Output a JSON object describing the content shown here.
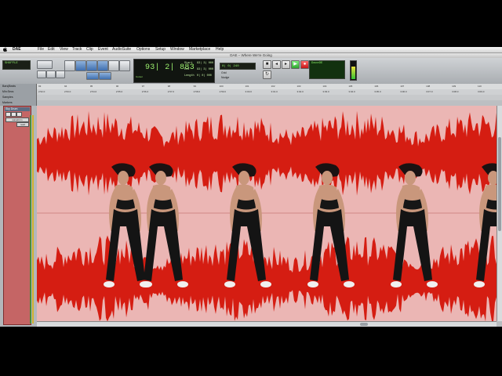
{
  "menubar": {
    "apple_icon": "apple-icon",
    "app": "DAE",
    "items": [
      "File",
      "Edit",
      "View",
      "Track",
      "Clip",
      "Event",
      "AudioSuite",
      "Options",
      "Setup",
      "Window",
      "Marketplace",
      "Help"
    ]
  },
  "window": {
    "title": "DAE – Where We're Going"
  },
  "toolbar": {
    "main_counter": "93| 2| 883",
    "counter_caption": "Cursor",
    "counter_side": [
      "Start",
      "End",
      "Length"
    ],
    "counter_side_values": [
      "93| 3| 000",
      "93| 3| 000",
      "0| 0| 000"
    ],
    "nudge_label": "Nudge",
    "grid_label": "Grid",
    "grid_value": "0| 0| 240",
    "left_lcd": "SHUFFLE",
    "right_lcd": "DaveDE"
  },
  "rulers": {
    "labels": [
      "Bars|Beats",
      "Min:Secs",
      "Samples",
      "Markers"
    ],
    "bar_ticks": [
      "93",
      "94",
      "95",
      "96",
      "97",
      "98",
      "99",
      "100",
      "101",
      "102",
      "103",
      "104",
      "105",
      "106",
      "107",
      "108",
      "109",
      "110"
    ],
    "time_ticks": [
      "2:52.0",
      "2:53.0",
      "2:54.0",
      "2:55.0",
      "2:56.0",
      "2:57.0",
      "2:58.0",
      "2:59.0",
      "3:00.0",
      "3:01.0",
      "3:02.0",
      "3:03.0",
      "3:04.0",
      "3:05.0",
      "3:06.0",
      "3:07.0",
      "3:08.0",
      "3:09.0"
    ]
  },
  "track": {
    "name": "Sky Drum",
    "buttons": [
      "R",
      "S",
      "M"
    ],
    "selector": "waveform",
    "sub_selector": "read"
  },
  "colors": {
    "waveform": "#d51d12",
    "clip_bg": "#ebb6b4",
    "track_strip": "#c56565",
    "toolbar_accent": "#3f6fb0"
  }
}
